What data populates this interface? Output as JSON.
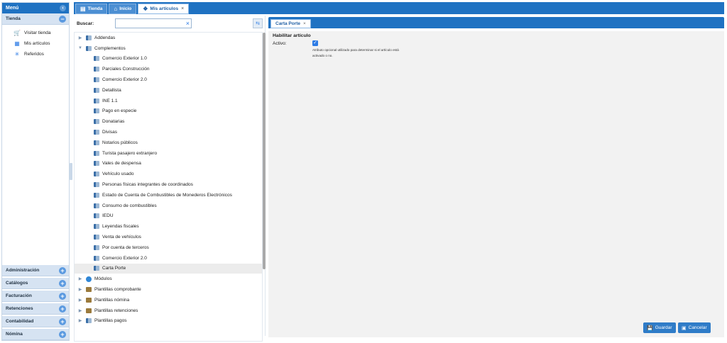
{
  "menu": {
    "title": "Menú",
    "collapse_icon": "chevron-left-icon",
    "tienda": {
      "label": "Tienda",
      "items": [
        {
          "label": "Visitar tienda",
          "icon": "cart-icon"
        },
        {
          "label": "Mis artículos",
          "icon": "grid-icon"
        },
        {
          "label": "Referidos",
          "icon": "asterisk-icon"
        }
      ]
    },
    "sections": [
      "Administración",
      "Catálogos",
      "Facturación",
      "Retenciones",
      "Contabilidad",
      "Nómina"
    ]
  },
  "top_tabs": [
    {
      "label": "Tienda",
      "icon": "store-icon"
    },
    {
      "label": "Inicio",
      "icon": "home-icon"
    },
    {
      "label": "Mis artículos",
      "icon": "box-icon",
      "closable": "×"
    }
  ],
  "search": {
    "label": "Buscar:",
    "value": "",
    "clear_icon": "×"
  },
  "tree": [
    {
      "label": "Addendas",
      "level": 0,
      "expanded": false,
      "icon": "doc"
    },
    {
      "label": "Complementos",
      "level": 0,
      "expanded": true,
      "icon": "doc"
    },
    {
      "label": "Comercio Exterior 1.0",
      "level": 1,
      "icon": "doc"
    },
    {
      "label": "Parciales Construcción",
      "level": 1,
      "icon": "doc"
    },
    {
      "label": "Comercio Exterior 2.0",
      "level": 1,
      "icon": "doc"
    },
    {
      "label": "Detallista",
      "level": 1,
      "icon": "doc"
    },
    {
      "label": "INE 1.1",
      "level": 1,
      "icon": "doc"
    },
    {
      "label": "Pago en especie",
      "level": 1,
      "icon": "doc"
    },
    {
      "label": "Donatarias",
      "level": 1,
      "icon": "doc"
    },
    {
      "label": "Divisas",
      "level": 1,
      "icon": "doc"
    },
    {
      "label": "Notarios públicos",
      "level": 1,
      "icon": "doc"
    },
    {
      "label": "Turista pasajero extranjero",
      "level": 1,
      "icon": "doc"
    },
    {
      "label": "Vales de despensa",
      "level": 1,
      "icon": "doc"
    },
    {
      "label": "Vehículo usado",
      "level": 1,
      "icon": "doc"
    },
    {
      "label": "Personas físicas integrantes de coordinados",
      "level": 1,
      "icon": "doc"
    },
    {
      "label": "Estado de Cuenta de Combustibles de Monederos Electrónicos",
      "level": 1,
      "icon": "doc"
    },
    {
      "label": "Consumo de combustibles",
      "level": 1,
      "icon": "doc"
    },
    {
      "label": "IEDU",
      "level": 1,
      "icon": "doc"
    },
    {
      "label": "Leyendas fiscales",
      "level": 1,
      "icon": "doc"
    },
    {
      "label": "Venta de vehículos",
      "level": 1,
      "icon": "doc"
    },
    {
      "label": "Por cuenta de terceros",
      "level": 1,
      "icon": "doc"
    },
    {
      "label": "Comercio Exterior 2.0",
      "level": 1,
      "icon": "doc"
    },
    {
      "label": "Carta Porte",
      "level": 1,
      "icon": "doc",
      "selected": true
    },
    {
      "label": "Módulos",
      "level": 0,
      "expanded": false,
      "icon": "mod"
    },
    {
      "label": "Plantillas comprobante",
      "level": 0,
      "expanded": false,
      "icon": "folder"
    },
    {
      "label": "Plantillas nómina",
      "level": 0,
      "expanded": false,
      "icon": "folder"
    },
    {
      "label": "Plantillas retenciones",
      "level": 0,
      "expanded": false,
      "icon": "folder"
    },
    {
      "label": "Plantillas pagos",
      "level": 0,
      "expanded": false,
      "icon": "doc"
    }
  ],
  "content_tab": {
    "label": "Carta Porte",
    "close": "×"
  },
  "form": {
    "title": "Habilitar artículo",
    "field_label": "Activo:",
    "checked": true,
    "help": "Atributo opcional utilizado para determinar si el artículo está activado o no."
  },
  "buttons": {
    "save": "Guardar",
    "cancel": "Cancelar"
  },
  "colors": {
    "accent": "#1f72c2",
    "section": "#d6e3f2",
    "button": "#2f7cc8"
  }
}
